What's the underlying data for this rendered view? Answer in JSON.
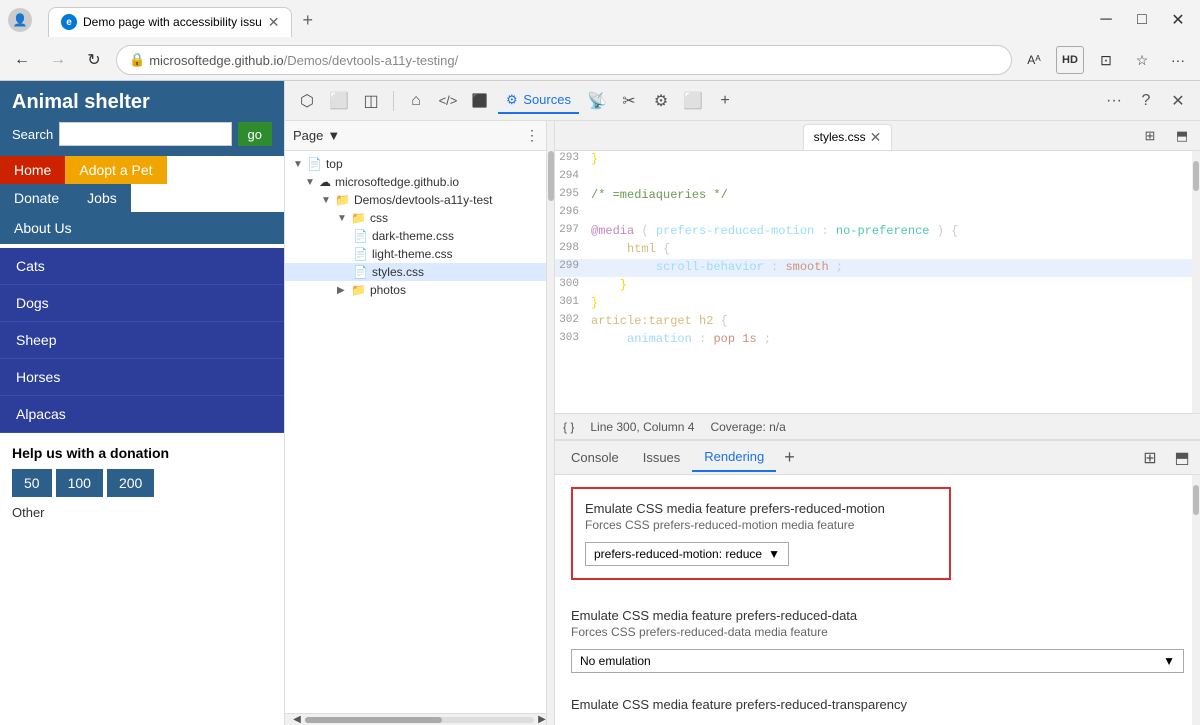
{
  "browser": {
    "tab_title": "Demo page with accessibility issu",
    "tab_favicon": "edge",
    "address": "microsoftedge.github.io/Demos/devtools-a11y-testing/",
    "address_prefix": "microsoftedge.github.io",
    "address_path": "/Demos/devtools-a11y-testing/",
    "nav_back": "←",
    "nav_fwd": "→",
    "nav_refresh": "↻",
    "address_icon": "🔒",
    "toolbar_aa": "Aᴬ",
    "toolbar_hd": "HD",
    "toolbar_mirror": "⊡",
    "toolbar_star": "☆",
    "toolbar_more": "···"
  },
  "website": {
    "title": "Animal shelter",
    "search_label": "Search",
    "search_placeholder": "",
    "search_btn": "go",
    "nav": {
      "home": "Home",
      "adopt": "Adopt a Pet",
      "donate": "Donate",
      "jobs": "Jobs",
      "about": "About Us"
    },
    "animals": [
      "Cats",
      "Dogs",
      "Sheep",
      "Horses",
      "Alpacas"
    ],
    "donation": {
      "title": "Help us with a donation",
      "amounts": [
        "50",
        "100",
        "200"
      ],
      "other": "Other"
    }
  },
  "devtools": {
    "toolbar_items": [
      "⬡",
      "⬜",
      "◫",
      "⌂",
      "</>",
      "⬛",
      "⚙",
      "📡",
      "⚙",
      "⚙",
      "⬜",
      "+"
    ],
    "panel_selector": "Page",
    "panel_more": "⋮",
    "file_tree": {
      "top": "top",
      "domain": "microsoftedge.github.io",
      "path": "Demos/devtools-a11y-test",
      "css_folder": "css",
      "files": [
        "dark-theme.css",
        "light-theme.css",
        "styles.css"
      ],
      "photos_folder": "photos"
    },
    "sources_tab": "Sources",
    "code_file": "styles.css",
    "code_lines": [
      {
        "num": "293",
        "content": "}"
      },
      {
        "num": "294",
        "content": ""
      },
      {
        "num": "295",
        "content": "/* =mediaqueries */"
      },
      {
        "num": "296",
        "content": ""
      },
      {
        "num": "297",
        "content": "@media (prefers-reduced-motion: no-preference) {"
      },
      {
        "num": "298",
        "content": "    html {"
      },
      {
        "num": "299",
        "content": "        scroll-behavior: smooth;"
      },
      {
        "num": "300",
        "content": "    }"
      },
      {
        "num": "301",
        "content": "}"
      },
      {
        "num": "302",
        "content": "article:target h2 {"
      },
      {
        "num": "303",
        "content": "    animation: pop 1s;"
      }
    ],
    "status_bar": {
      "braces": "{ }",
      "line_col": "Line 300, Column 4",
      "coverage": "Coverage: n/a"
    },
    "bottom_tabs": [
      "Console",
      "Issues",
      "Rendering"
    ],
    "active_bottom_tab": "Rendering",
    "rendering": {
      "section1": {
        "title": "Emulate CSS media feature prefers-reduced-motion",
        "desc": "Forces CSS prefers-reduced-motion media feature",
        "select_value": "prefers-reduced-motion: reduce",
        "select_arrow": "▼"
      },
      "section2": {
        "title": "Emulate CSS media feature prefers-reduced-data",
        "desc": "Forces CSS prefers-reduced-data media feature",
        "select_value": "No emulation",
        "select_arrow": "▼"
      },
      "section3": {
        "title": "Emulate CSS media feature prefers-reduced-transparency"
      }
    }
  }
}
